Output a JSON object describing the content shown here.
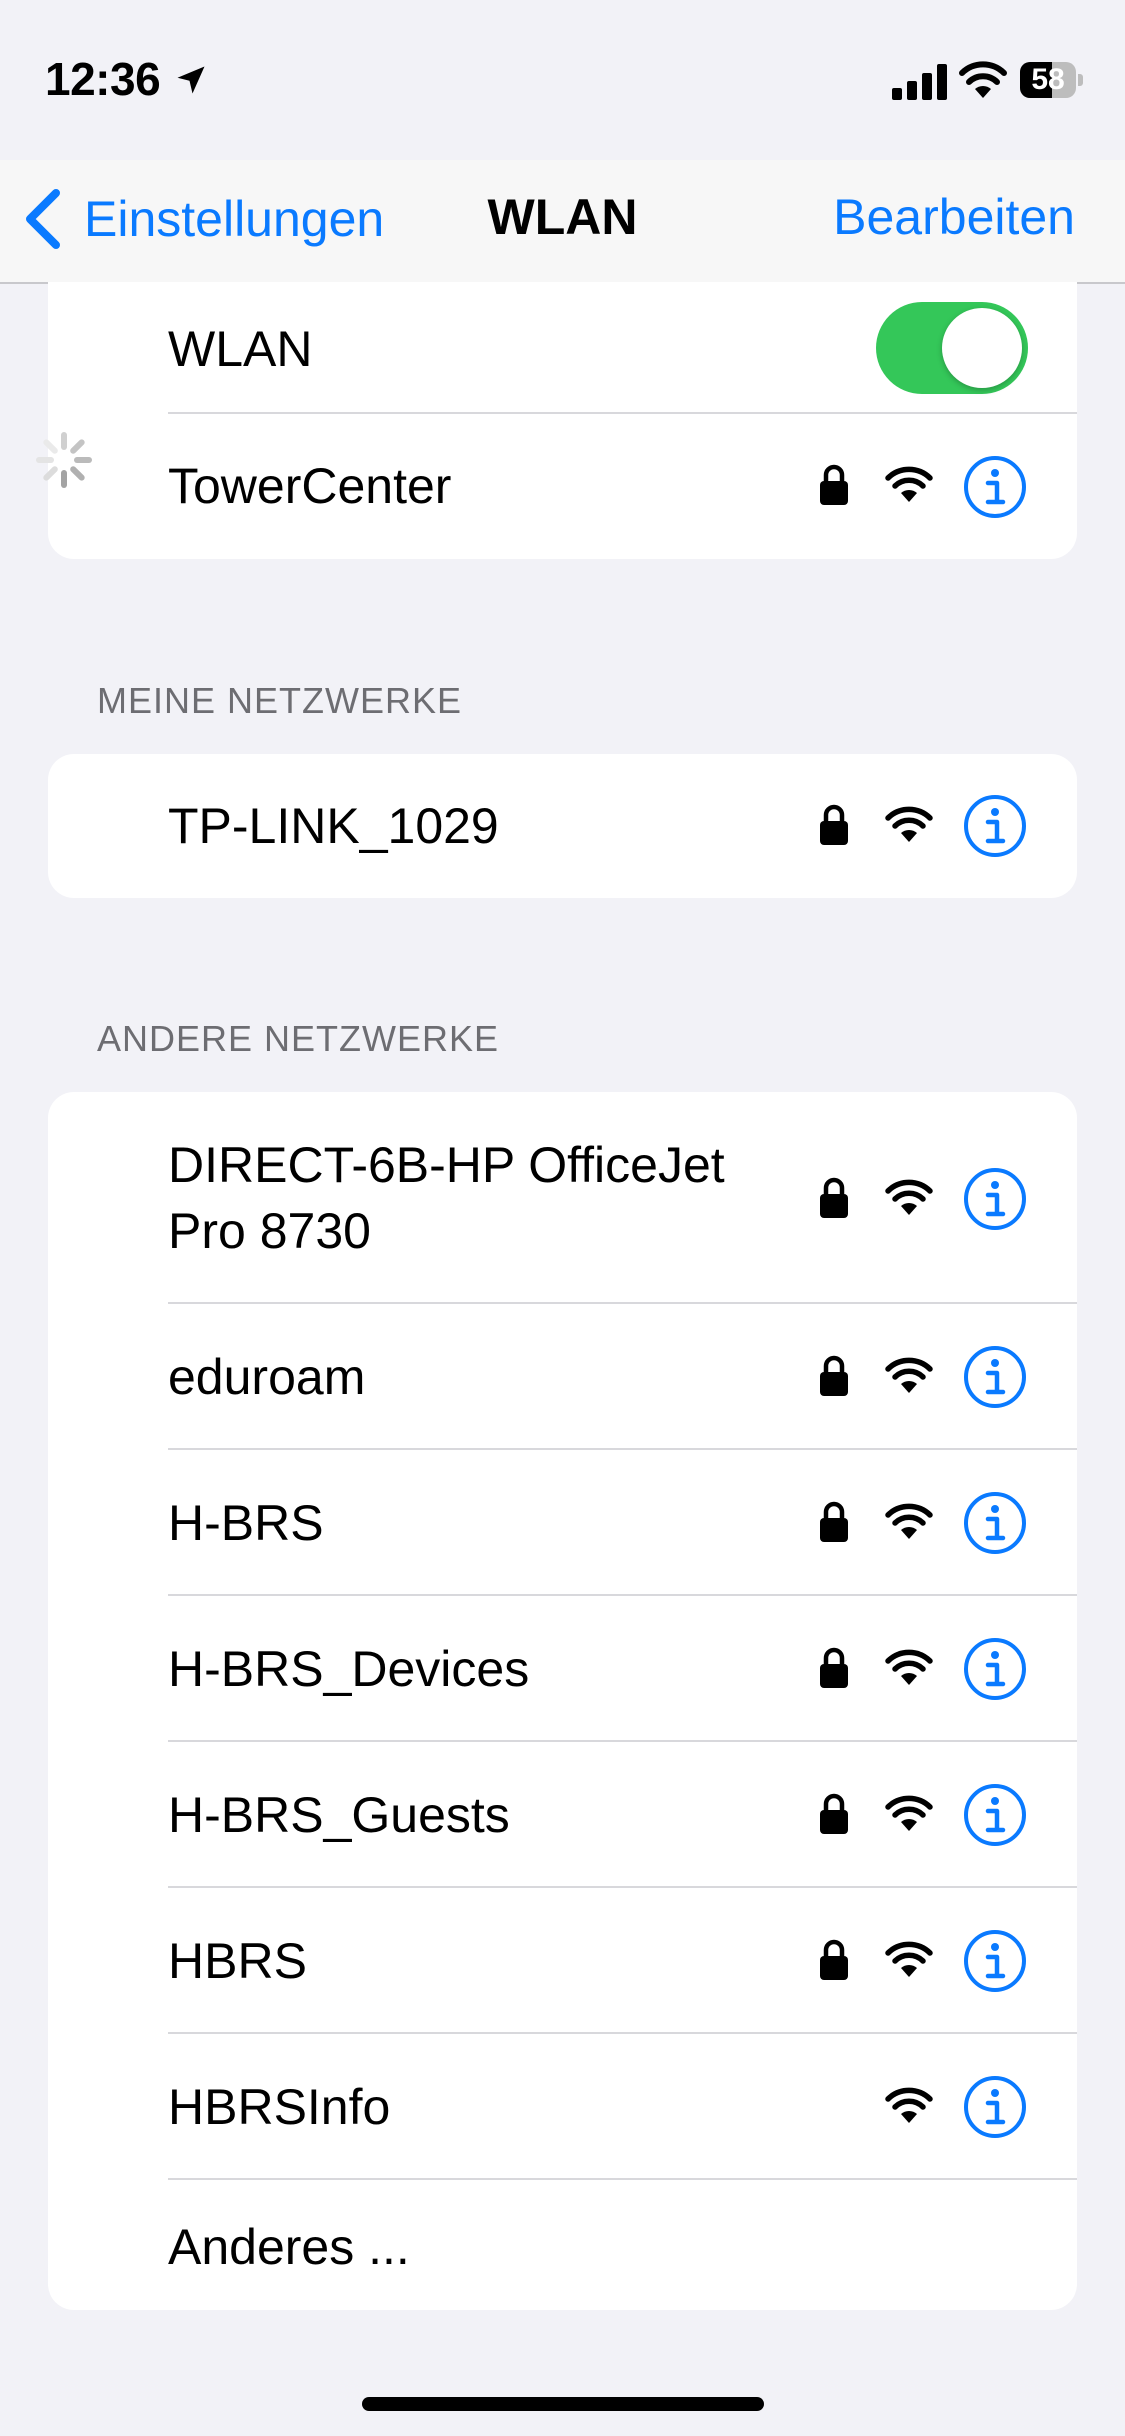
{
  "status_bar": {
    "time": "12:36",
    "battery_level": "58",
    "battery_fraction": 0.58
  },
  "nav": {
    "back_label": "Einstellungen",
    "title": "WLAN",
    "edit_label": "Bearbeiten"
  },
  "wlan": {
    "label": "WLAN",
    "enabled": true
  },
  "current_network": {
    "name": "TowerCenter",
    "secured": true,
    "connecting": true
  },
  "my_networks": {
    "header": "MEINE NETZWERKE",
    "items": [
      {
        "name": "TP-LINK_1029",
        "secured": true
      }
    ]
  },
  "other_networks": {
    "header": "ANDERE NETZWERKE",
    "items": [
      {
        "name_line1": "DIRECT-6B-HP OfficeJet",
        "name_line2": "Pro 8730",
        "secured": true
      },
      {
        "name": "eduroam",
        "secured": true
      },
      {
        "name": "H-BRS",
        "secured": true
      },
      {
        "name": "H-BRS_Devices",
        "secured": true
      },
      {
        "name": "H-BRS_Guests",
        "secured": true
      },
      {
        "name": "HBRS",
        "secured": true
      },
      {
        "name": "HBRSInfo",
        "secured": false
      }
    ],
    "other_label": "Anderes ..."
  },
  "colors": {
    "accent": "#0a7aff",
    "toggle_on": "#34c759",
    "background": "#f2f2f7"
  },
  "icons": [
    "location-arrow-icon",
    "cellular-signal-icon",
    "wifi-status-icon",
    "battery-icon",
    "chevron-left-icon",
    "loading-spinner-icon",
    "lock-icon",
    "wifi-icon",
    "info-icon"
  ]
}
